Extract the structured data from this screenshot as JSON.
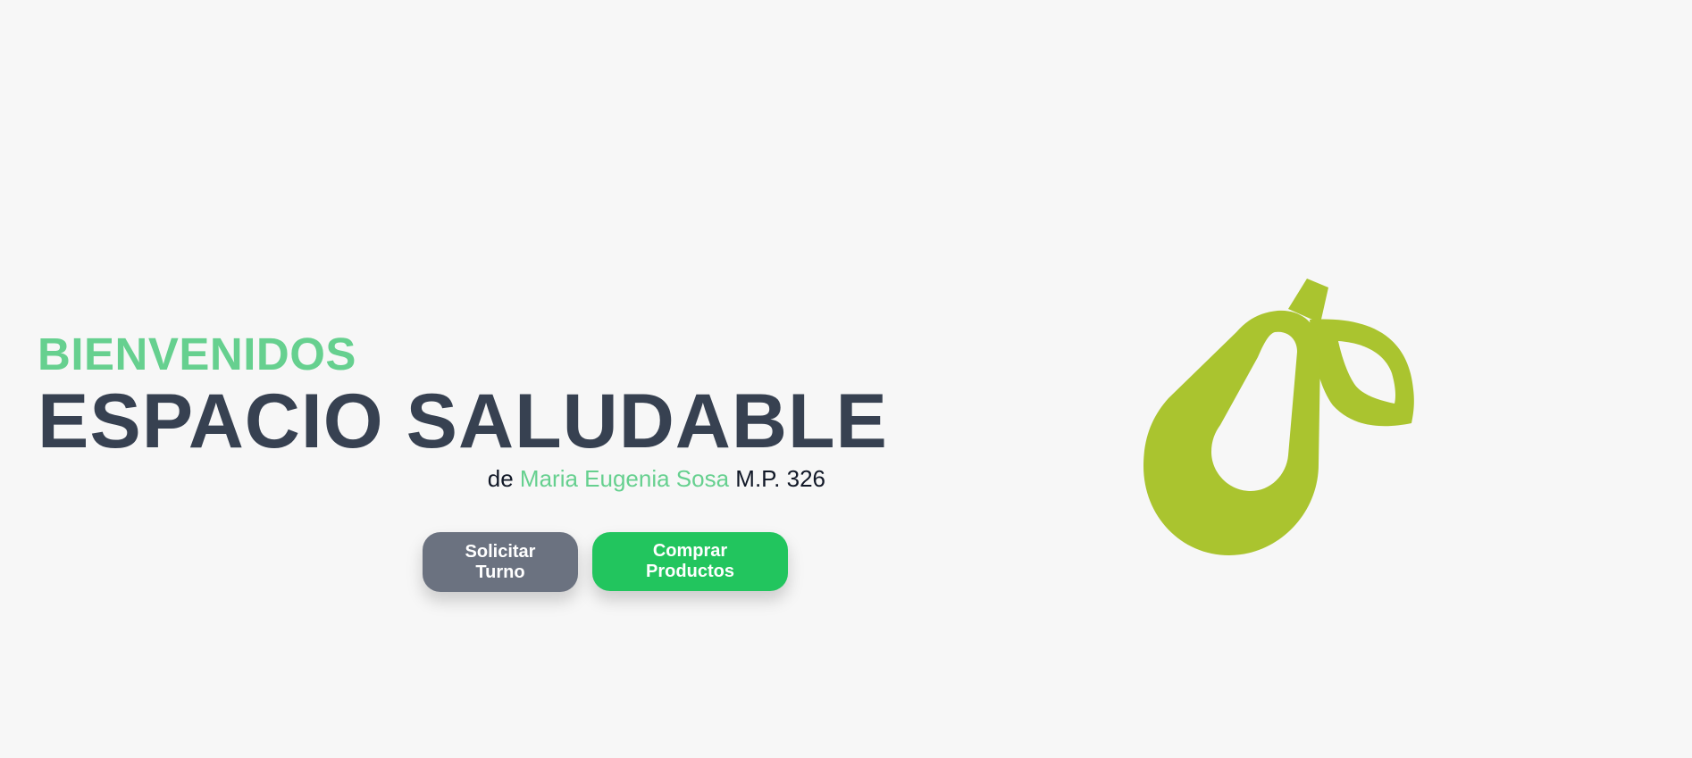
{
  "hero": {
    "welcome": "BIENVENIDOS",
    "title": "ESPACIO SALUDABLE",
    "subtitle_prefix": "de ",
    "subtitle_name": "Maria Eugenia Sosa",
    "subtitle_suffix": " M.P. 326"
  },
  "buttons": {
    "appointment_label": "Solicitar Turno",
    "products_label": "Comprar Productos"
  },
  "logo": {
    "icon": "pear-icon",
    "color": "#aac42f"
  },
  "colors": {
    "background": "#f7f7f7",
    "accent": "#66d08f",
    "title": "#374151",
    "button_gray": "#6b7280",
    "button_green": "#22c55e"
  }
}
